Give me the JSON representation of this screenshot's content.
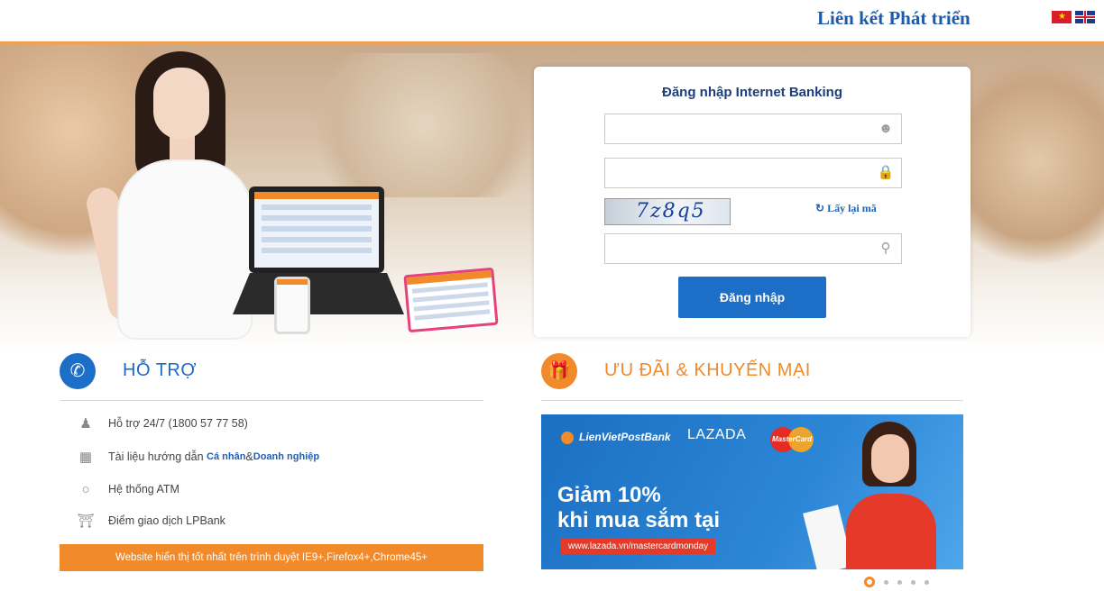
{
  "header": {
    "slogan": "Liên kết Phát triển",
    "languages": [
      {
        "code": "vi",
        "icon": "vietnam-flag-icon"
      },
      {
        "code": "en",
        "icon": "uk-flag-icon"
      }
    ]
  },
  "login": {
    "title": "Đăng nhập Internet Banking",
    "username": {
      "value": "",
      "placeholder": "",
      "icon": "user-icon"
    },
    "password": {
      "value": "",
      "placeholder": "",
      "icon": "lock-icon"
    },
    "captcha_text": "7z8q5",
    "refresh_label": "Lấy lại mã",
    "captcha_input": {
      "value": "",
      "placeholder": "",
      "icon": "key-icon"
    },
    "submit_label": "Đăng nhập"
  },
  "support": {
    "title": "HỖ TRỢ",
    "items": [
      {
        "icon": "support-person-icon",
        "text": "Hỗ trợ 24/7 (1800 57 77 58)"
      },
      {
        "icon": "document-icon",
        "text": "Tài liệu hướng dẫn",
        "link1": "Cá nhân",
        "sep": " & ",
        "link2": "Doanh nghiệp"
      },
      {
        "icon": "location-pin-icon",
        "text": "Hệ thống ATM"
      },
      {
        "icon": "bank-icon",
        "text": "Điểm giao dịch LPBank"
      }
    ],
    "browser_note": "Website hiển thị tốt nhất trên trình duyệt IE9+,Firefox4+,Chrome45+"
  },
  "promo": {
    "title": "ƯU ĐÃI & KHUYẾN MẠI",
    "banner": {
      "brand1": "LienVietPostBank",
      "brand2": "LAZADA",
      "brand3": "MasterCard",
      "line1": "Giảm 10%",
      "line2": "khi mua sắm tại",
      "url": "www.lazada.vn/mastercardmonday"
    },
    "pager_count": 5,
    "pager_active": 0
  },
  "colors": {
    "brand_blue": "#1e5aa8",
    "accent_orange": "#f08a2a",
    "button_blue": "#1c6ec7"
  }
}
